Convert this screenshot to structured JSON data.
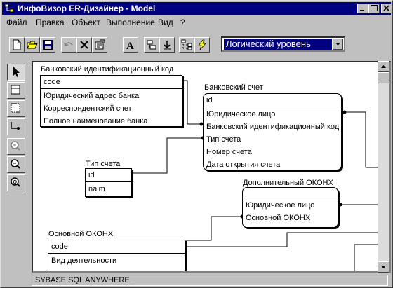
{
  "window": {
    "title": "ИнфоВизор ER-Дизайнер - Model"
  },
  "menu": {
    "items": [
      "Файл",
      "Правка",
      "Объект",
      "Выполнение",
      "Вид",
      "?"
    ]
  },
  "toolbar": {
    "level_select": "Логический уровень",
    "tools": [
      "new-file-icon",
      "open-folder-icon",
      "save-disk-icon",
      "undo-icon",
      "delete-icon",
      "properties-icon",
      "font-icon",
      "schema-icon",
      "download-icon",
      "relation-tree-icon",
      "lightning-icon"
    ]
  },
  "palette": {
    "tools": [
      "pointer-icon",
      "entity-tool-icon",
      "subtype-tool-icon",
      "relationship-tool-icon",
      "zoom-in-icon",
      "zoom-out-icon",
      "zoom-fit-icon"
    ]
  },
  "diagram": {
    "entities": {
      "bank_id_code": {
        "title": "Банковский идентификационный код",
        "key": "code",
        "attributes": [
          "Юридический адрес банка",
          "Корреспондентский счет",
          "Полное наименование банка"
        ]
      },
      "bank_account": {
        "title": "Банковский счет",
        "key": "id",
        "attributes": [
          "Юридическое лицо",
          "Банковский идентификационный код",
          "Тип счета",
          "Номер счета",
          "Дата открытия счета"
        ]
      },
      "account_type": {
        "title": "Тип счета",
        "key": "id",
        "attributes": [
          "naim"
        ]
      },
      "additional_okonh": {
        "title": "Дополнительный ОКОНХ",
        "key": "",
        "attributes": [
          "Юридическое лицо",
          "Основной ОКОНХ"
        ]
      },
      "main_okonh": {
        "title": "Основной ОКОНХ",
        "key": "code",
        "attributes": [
          "Вид деятельности"
        ]
      }
    }
  },
  "status": {
    "text": "SYBASE SQL ANYWHERE"
  },
  "colors": {
    "titlebar": "#000080",
    "face": "#c0c0c0",
    "canvas": "#ffffff"
  }
}
